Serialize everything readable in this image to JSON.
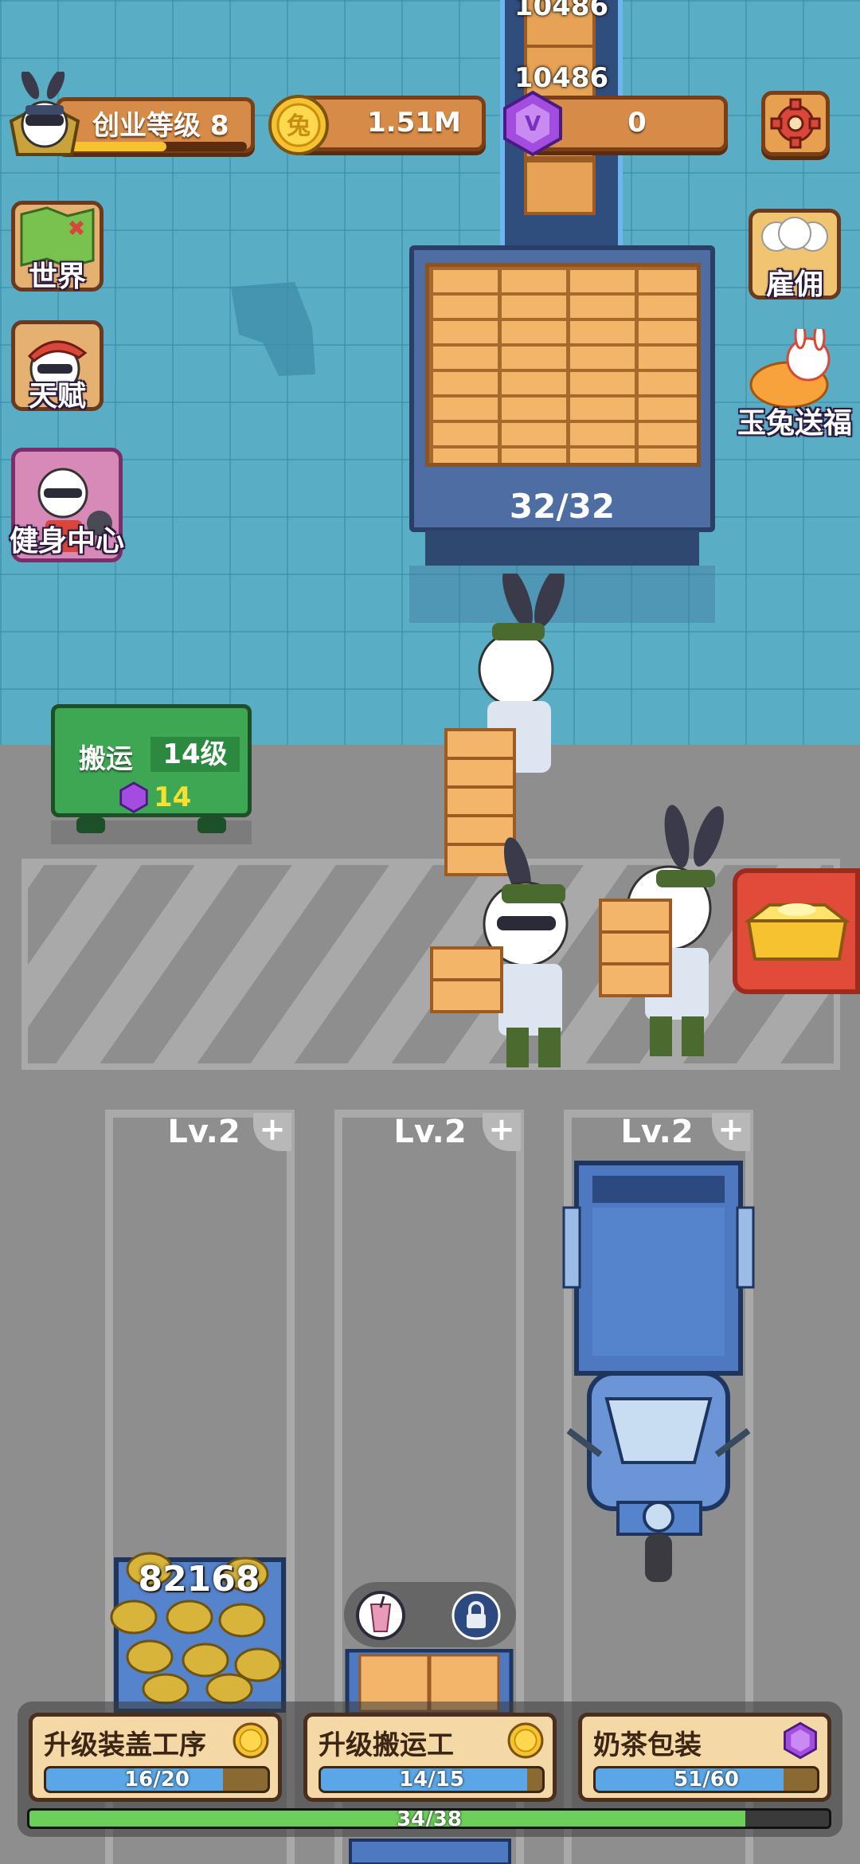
{
  "hud": {
    "level_label": "创业等级 8",
    "level_progress": 0.55,
    "coins": "1.51M",
    "gems": "0"
  },
  "conveyor": {
    "count_top": "10486",
    "count_main": "10486"
  },
  "station": {
    "counter": "32/32"
  },
  "side_left": {
    "world": "世界",
    "talent": "天赋",
    "gym": "健身中心"
  },
  "side_right": {
    "hire": "雇佣",
    "blessing": "玉兔送福"
  },
  "carry_board": {
    "title": "搬运",
    "level": "14级",
    "gem_cost": "14"
  },
  "lanes": [
    {
      "label": "Lv.2"
    },
    {
      "label": "Lv.2"
    },
    {
      "label": "Lv.2"
    }
  ],
  "coin_pile": {
    "count": "82168"
  },
  "upgrades": [
    {
      "title": "升级装盖工序",
      "progress": "16/20",
      "ratio": 0.8,
      "currency": "coin-icon"
    },
    {
      "title": "升级搬运工",
      "progress": "14/15",
      "ratio": 0.93,
      "currency": "coin-icon"
    },
    {
      "title": "奶茶包装",
      "progress": "51/60",
      "ratio": 0.85,
      "currency": "gem-icon"
    }
  ],
  "overall": {
    "progress": "34/38",
    "ratio": 0.895
  },
  "colors": {
    "tile_floor": "#59aec6",
    "road": "#8e8e8e",
    "hud_wood": "#d68c48",
    "gem_purple": "#a24de0",
    "coin_gold": "#f6c230"
  }
}
